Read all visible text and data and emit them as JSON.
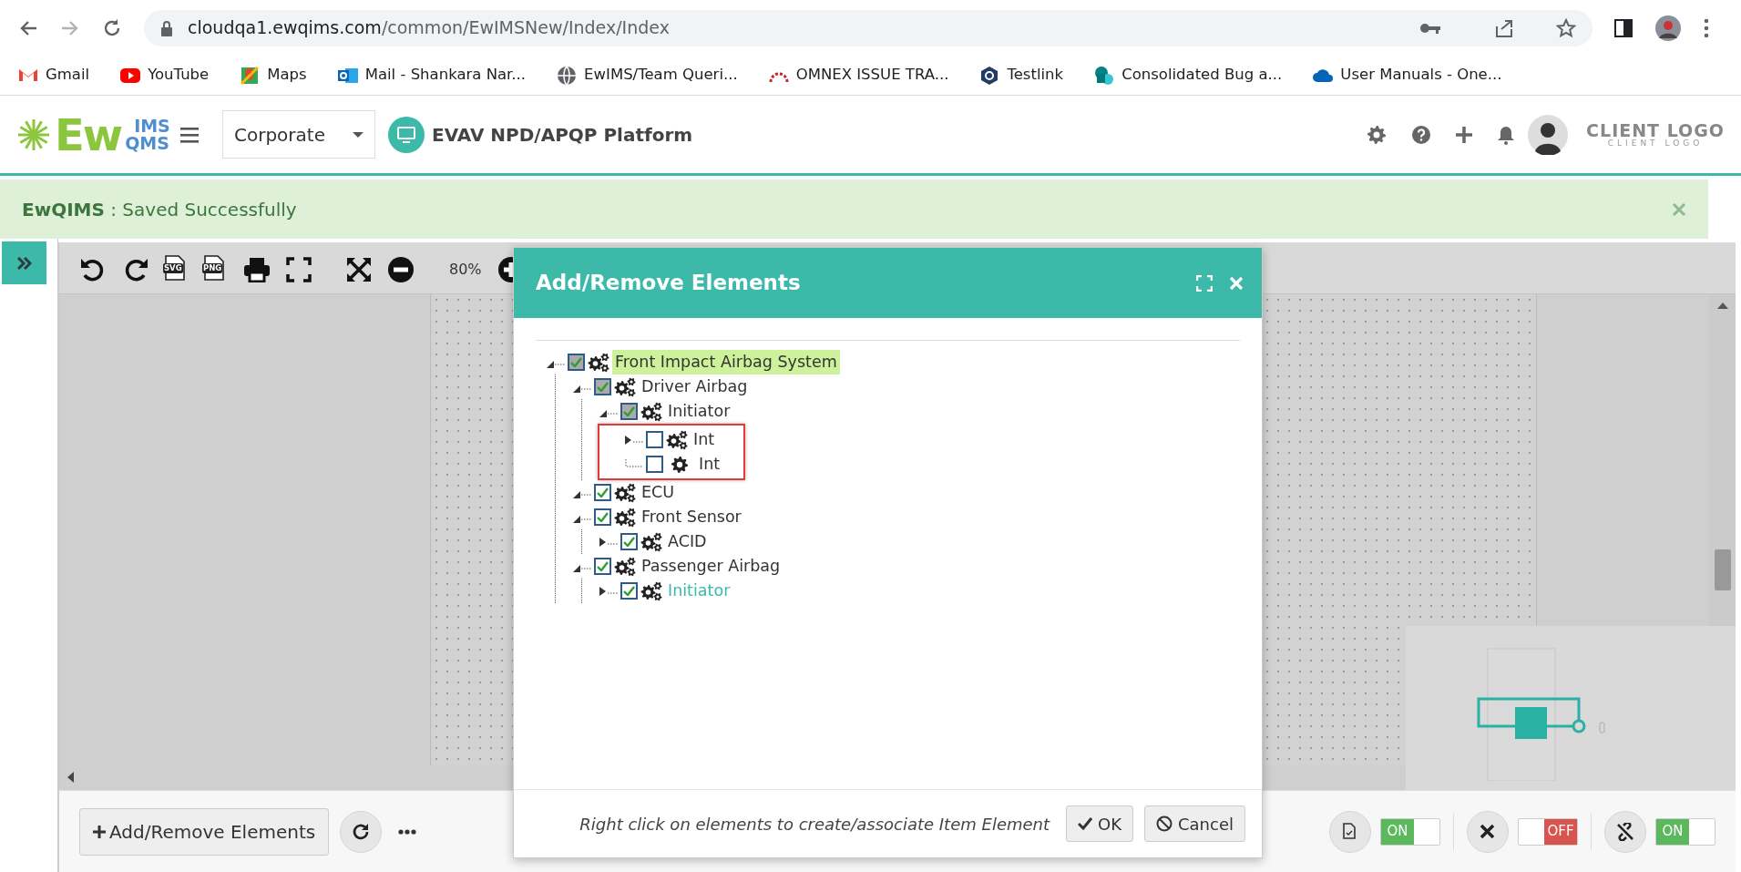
{
  "browser": {
    "url_host": "cloudqa1.ewqims.com",
    "url_path": "/common/EwIMSNew/Index/Index",
    "bookmarks": [
      {
        "label": "Gmail"
      },
      {
        "label": "YouTube"
      },
      {
        "label": "Maps"
      },
      {
        "label": "Mail - Shankara Nar..."
      },
      {
        "label": "EwIMS/Team Queri..."
      },
      {
        "label": "OMNEX ISSUE TRA..."
      },
      {
        "label": "Testlink"
      },
      {
        "label": "Consolidated Bug a..."
      },
      {
        "label": "User Manuals - One..."
      }
    ]
  },
  "header": {
    "logo": {
      "main": "Ew",
      "top": "IMS",
      "bottom": "QMS"
    },
    "site": "Corporate",
    "platform": "EVAV NPD/APQP Platform",
    "client_logo": {
      "title": "CLIENT LOGO",
      "subtitle": "CLIENT LOGO"
    }
  },
  "alert": {
    "text": "**EwQIMS** : Saved Successfully"
  },
  "toolbar": {
    "exports": [
      {
        "label": "SVG"
      },
      {
        "label": "PNG"
      }
    ],
    "zoom": "80%"
  },
  "modal": {
    "title": "Add/Remove Elements",
    "tree": [
      {
        "label": "Front Impact Airbag System",
        "kind": "assembly",
        "checked": true,
        "partial": true,
        "expanded": true,
        "selected": true,
        "hovered": false,
        "children": [
          {
            "label": "Driver Airbag",
            "kind": "assembly",
            "checked": true,
            "partial": true,
            "expanded": true,
            "selected": false,
            "hovered": false,
            "children": [
              {
                "label": "Initiator",
                "kind": "assembly",
                "checked": true,
                "partial": true,
                "expanded": true,
                "selected": false,
                "hovered": false,
                "outlined": true,
                "children": [
                  {
                    "label": "Int",
                    "kind": "assembly",
                    "checked": false,
                    "partial": false,
                    "expanded": false,
                    "selected": false,
                    "hovered": false
                  },
                  {
                    "label": "Int",
                    "kind": "part",
                    "checked": false,
                    "partial": false,
                    "selected": false,
                    "hovered": false
                  }
                ]
              }
            ]
          },
          {
            "label": "ECU",
            "kind": "assembly",
            "checked": true,
            "partial": false,
            "expanded": true,
            "selected": false,
            "hovered": false
          },
          {
            "label": "Front Sensor",
            "kind": "assembly",
            "checked": true,
            "partial": false,
            "expanded": true,
            "selected": false,
            "hovered": false,
            "children": [
              {
                "label": "ACID",
                "kind": "assembly",
                "checked": true,
                "partial": false,
                "expanded": false,
                "selected": false,
                "hovered": false
              }
            ]
          },
          {
            "label": "Passenger Airbag",
            "kind": "assembly",
            "checked": true,
            "partial": false,
            "expanded": true,
            "selected": false,
            "hovered": false,
            "children": [
              {
                "label": "Initiator",
                "kind": "assembly",
                "checked": true,
                "partial": false,
                "expanded": false,
                "selected": false,
                "hovered": true
              }
            ]
          }
        ]
      }
    ],
    "hint": "Right click on elements to create/associate Item Element",
    "buttons": [
      {
        "label": "OK",
        "kind": "ok"
      },
      {
        "label": "Cancel",
        "kind": "cancel"
      }
    ]
  },
  "bottom_bar": {
    "add_button": "Add/Remove Elements",
    "toggles": [
      {
        "label": "ON",
        "on": true
      },
      {
        "label": "OFF",
        "on": false
      },
      {
        "label": "ON",
        "on": true
      }
    ]
  }
}
